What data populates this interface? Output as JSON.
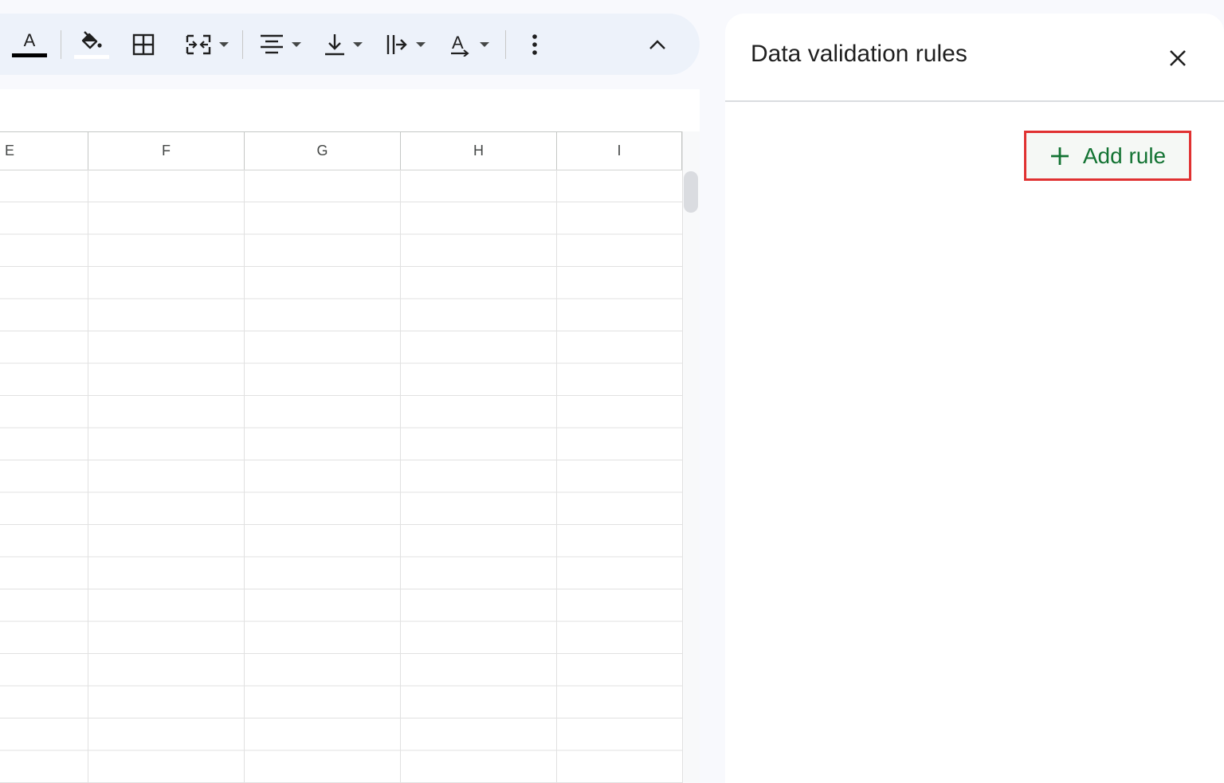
{
  "toolbar": {
    "text_color_glyph": "A",
    "text_color_value": "#000000",
    "fill_color_value": "#ffffff",
    "items": [
      {
        "name": "text-color",
        "icon": "text-color-icon"
      },
      {
        "name": "fill-color",
        "icon": "paint-bucket-icon"
      },
      {
        "name": "borders",
        "icon": "borders-icon"
      },
      {
        "name": "merge-cells",
        "icon": "merge-cells-icon"
      },
      {
        "name": "horizontal-align",
        "icon": "align-center-icon"
      },
      {
        "name": "vertical-align",
        "icon": "align-bottom-icon"
      },
      {
        "name": "text-wrapping",
        "icon": "text-wrap-icon"
      },
      {
        "name": "text-rotation",
        "icon": "text-rotation-icon"
      },
      {
        "name": "more",
        "icon": "more-vert-icon"
      },
      {
        "name": "collapse",
        "icon": "chevron-up-icon"
      }
    ]
  },
  "sheet": {
    "columns": [
      "E",
      "F",
      "G",
      "H",
      "I"
    ]
  },
  "panel": {
    "title": "Data validation rules",
    "close_icon": "close-icon",
    "add_rule_label": "Add rule",
    "add_rule_icon": "plus-icon",
    "highlight_color": "#e03131",
    "accent_color": "#137333"
  }
}
